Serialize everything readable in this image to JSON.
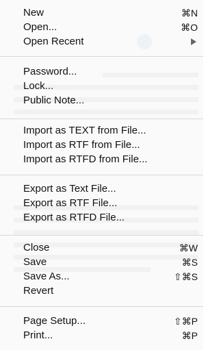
{
  "menu": {
    "items": [
      {
        "label": "New",
        "shortcut": "⌘N"
      },
      {
        "label": "Open...",
        "shortcut": "⌘O"
      },
      {
        "label": "Open Recent",
        "submenu": true
      },
      {
        "label": "Password..."
      },
      {
        "label": "Lock..."
      },
      {
        "label": "Public Note..."
      },
      {
        "label": "Import as TEXT from File..."
      },
      {
        "label": "Import as RTF from File..."
      },
      {
        "label": "Import as RTFD from File..."
      },
      {
        "label": "Export as Text File..."
      },
      {
        "label": "Export as RTF File..."
      },
      {
        "label": "Export as RTFD File..."
      },
      {
        "label": "Close",
        "shortcut": "⌘W"
      },
      {
        "label": "Save",
        "shortcut": "⌘S"
      },
      {
        "label": "Save As...",
        "shortcut": "⇧⌘S"
      },
      {
        "label": "Revert"
      },
      {
        "label": "Page Setup...",
        "shortcut": "⇧⌘P"
      },
      {
        "label": "Print...",
        "shortcut": "⌘P"
      }
    ],
    "submenu_icon": "chevron-right-icon"
  }
}
